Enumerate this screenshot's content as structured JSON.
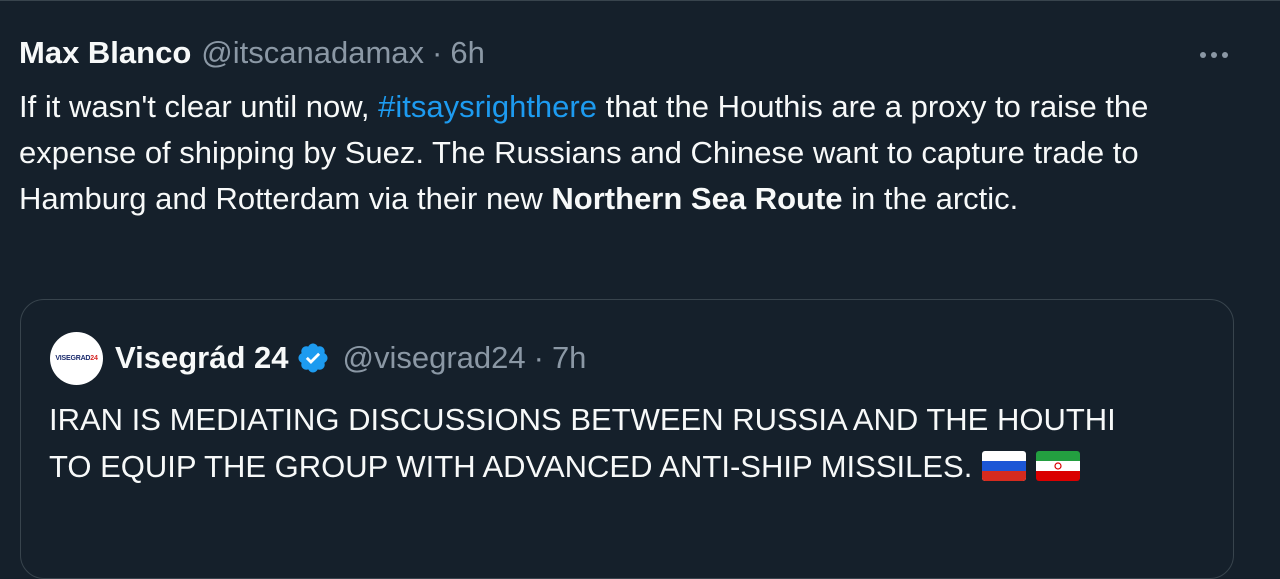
{
  "tweet": {
    "author_name": "Max Blanco",
    "author_handle": "@itscanadamax",
    "separator": "·",
    "time": "6h",
    "more_icon": "more-horizontal-icon",
    "text_part1": "If it wasn't clear until now, ",
    "hashtag": "#itsaysrighthere",
    "text_part2": " that the Houthis are a proxy to raise the expense of shipping by Suez. The Russians and Chinese want to capture trade to Hamburg and Rotterdam via their new ",
    "bold_text": "Northern Sea Route",
    "text_part3": " in the arctic."
  },
  "quote": {
    "avatar_text_main": "VISEGRAD",
    "avatar_text_num": "24",
    "author_name": "Visegrád 24",
    "verified_icon": "verified-badge-icon",
    "author_handle": "@visegrad24",
    "separator": "·",
    "time": "7h",
    "text": "IRAN IS MEDIATING DISCUSSIONS BETWEEN RUSSIA AND THE HOUTHI TO EQUIP THE GROUP WITH ADVANCED ANTI-SHIP MISSILES.",
    "flags": [
      "russia-flag-icon",
      "iran-flag-icon"
    ]
  },
  "colors": {
    "background": "#15202b",
    "text": "#f7f9f9",
    "secondary": "#8b98a5",
    "link": "#1d9bf0",
    "border": "#38444d"
  }
}
